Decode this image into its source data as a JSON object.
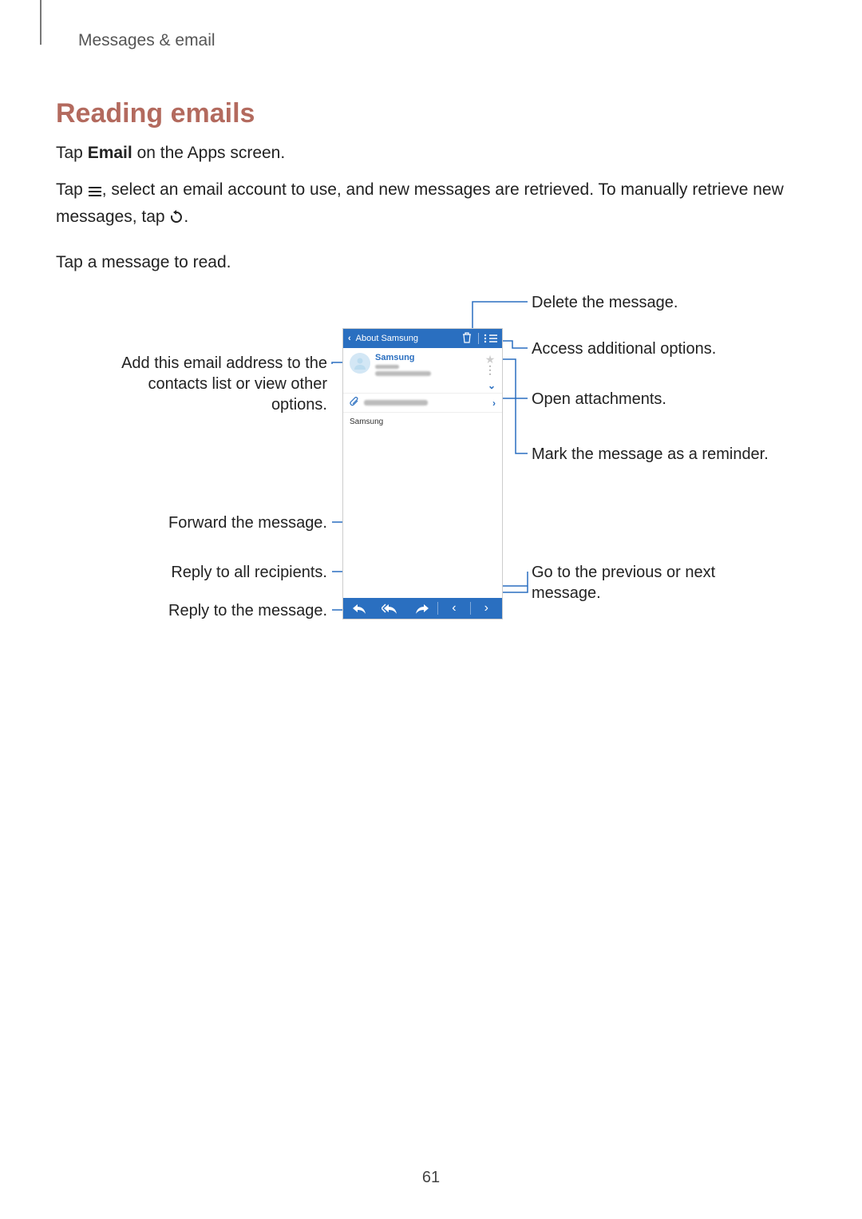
{
  "breadcrumb": "Messages & email",
  "heading": "Reading emails",
  "para1_pre": "Tap ",
  "para1_bold": "Email",
  "para1_post": " on the Apps screen.",
  "para2_a": "Tap ",
  "para2_b": ", select an email account to use, and new messages are retrieved. To manually retrieve new messages, tap ",
  "para2_c": ".",
  "para3": "Tap a message to read.",
  "callouts": {
    "delete": "Delete the message.",
    "options": "Access additional options.",
    "contact": "Add this email address to the contacts list or view other options.",
    "attach": "Open attachments.",
    "reminder": "Mark the message as a reminder.",
    "forward": "Forward the message.",
    "replyall": "Reply to all recipients.",
    "reply": "Reply to the message.",
    "nav": "Go to the previous or next message."
  },
  "phone": {
    "title": "About Samsung",
    "sender": "Samsung",
    "body": "Samsung"
  },
  "page_number": "61"
}
